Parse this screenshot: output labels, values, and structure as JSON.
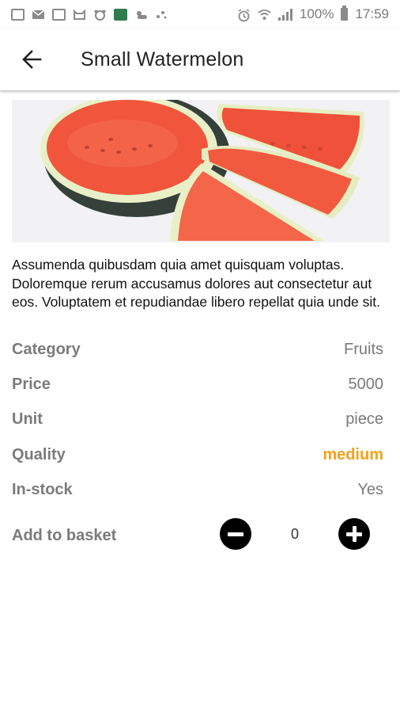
{
  "status_bar": {
    "battery_percent": "100%",
    "time": "17:59",
    "left_icons": [
      "image-icon",
      "mail-icon",
      "calendar-icon",
      "cat-icon",
      "bear-icon",
      "app-icon",
      "weather-icon",
      "dots-icon"
    ],
    "right_icons": [
      "alarm-icon",
      "wifi-icon",
      "signal-icon",
      "battery-icon"
    ]
  },
  "app_bar": {
    "back_icon": "arrow-left-icon",
    "title": "Small Watermelon"
  },
  "product": {
    "image_subject": "watermelon",
    "description": "Assumenda quibusdam quia amet quisquam voluptas. Doloremque rerum accusamus dolores aut consectetur aut eos. Voluptatem et repudiandae libero repellat quia unde sit.",
    "details": [
      {
        "label": "Category",
        "value": "Fruits"
      },
      {
        "label": "Price",
        "value": "5000"
      },
      {
        "label": "Unit",
        "value": "piece"
      },
      {
        "label": "Quality",
        "value": "medium"
      },
      {
        "label": "In-stock",
        "value": "Yes"
      }
    ],
    "basket": {
      "label": "Add to basket",
      "quantity": "0"
    }
  },
  "colors": {
    "quality_accent": "#f4a11a",
    "label_gray": "#7b7b7b"
  }
}
